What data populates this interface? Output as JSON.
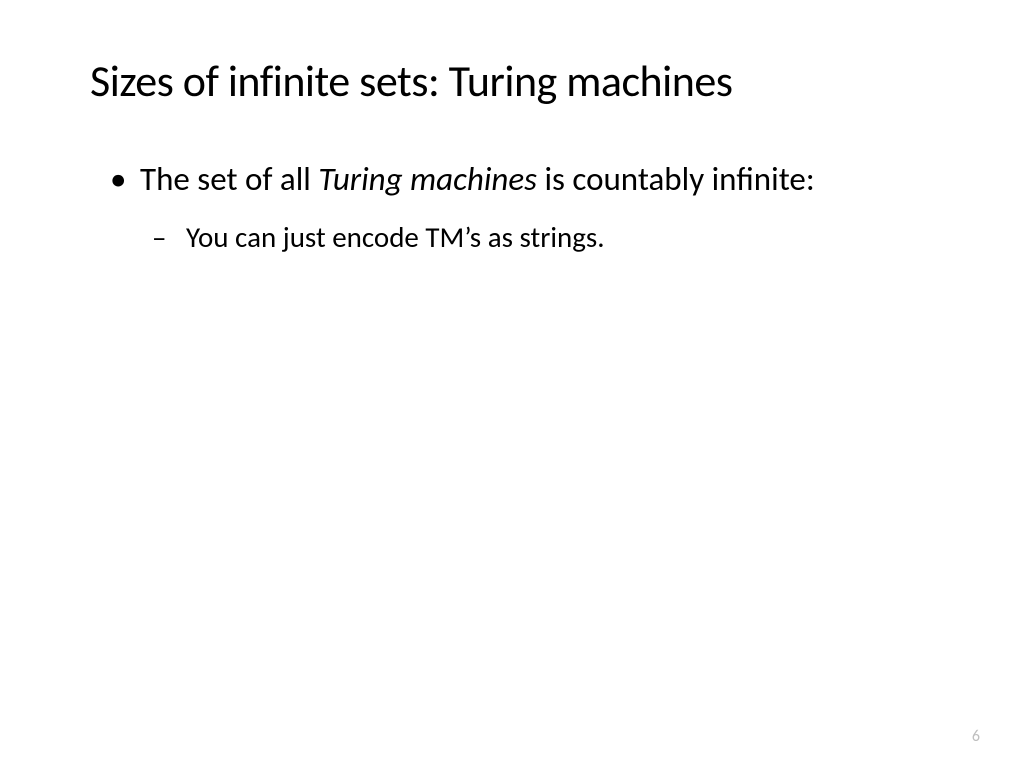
{
  "title": "Sizes of infinite sets: Turing machines",
  "bullet1_pre": "The set of all ",
  "bullet1_italic": "Turing machines",
  "bullet1_post": " is countably infinite:",
  "sub1": "You can just encode TM’s as strings.",
  "page_number": "6"
}
